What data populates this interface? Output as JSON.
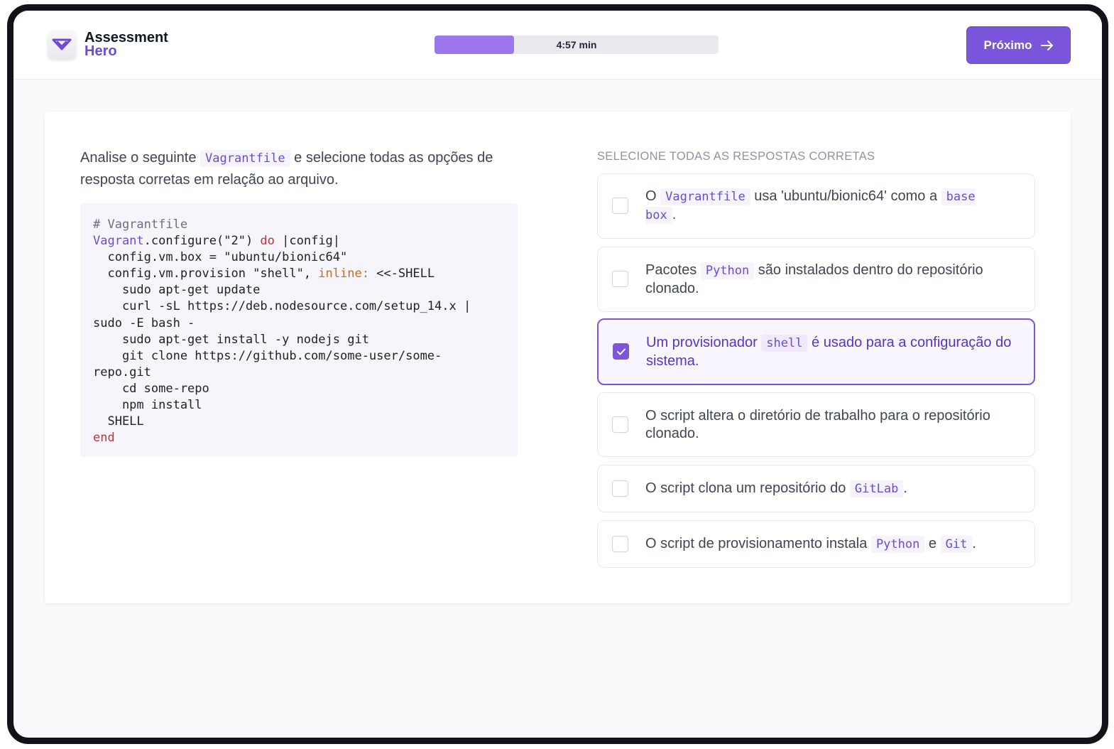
{
  "app": {
    "logo_line1": "Assessment",
    "logo_line2": "Hero",
    "brand_color": "#7c55dd"
  },
  "timer": {
    "label": "4:57 min",
    "progress": 0.28
  },
  "next_button": {
    "label": "Próximo",
    "icon": "arrow-right-icon"
  },
  "question": {
    "text_before": "Analise o seguinte ",
    "code": "Vagrantfile",
    "text_after": " e selecione todas as opções de resposta corretas em relação ao arquivo."
  },
  "code_block": {
    "language": "ruby",
    "comment": "# Vagrantfile",
    "line2_class": "Vagrant",
    "line2_rest": ".configure(\"2\") ",
    "line2_kw": "do",
    "line2_end": " |config|",
    "line3": "  config.vm.box = \"ubuntu/bionic64\"",
    "line4_start": "  config.vm.provision \"shell\", ",
    "line4_sym": "inline:",
    "line4_end": " <<-SHELL",
    "line5": "    sudo apt-get update",
    "line6": "    curl -sL https://deb.nodesource.com/setup_14.x |",
    "line7": "sudo -E bash -",
    "line8": "    sudo apt-get install -y nodejs git",
    "line9": "    git clone https://github.com/some-user/some-",
    "line10": "repo.git",
    "line11": "    cd some-repo",
    "line12": "    npm install",
    "line13": "  SHELL",
    "line14": "end"
  },
  "answers": {
    "header": "SELECIONE TODAS AS RESPOSTAS CORRETAS",
    "options": [
      {
        "checked": false,
        "t1": "O ",
        "c1": "Vagrantfile",
        "t2": " usa 'ubuntu/bionic64' como a ",
        "c2": "base box",
        "t3": "."
      },
      {
        "checked": false,
        "t1": "Pacotes ",
        "c1": "Python",
        "t2": " são instalados dentro do repositório clonado."
      },
      {
        "checked": true,
        "t1": "Um provisionador ",
        "c1": "shell",
        "t2": " é usado para a configuração do sistema."
      },
      {
        "checked": false,
        "t1": "O script altera o diretório de trabalho para o repositório clonado."
      },
      {
        "checked": false,
        "t1": "O script clona um repositório do ",
        "c1": "GitLab",
        "t2": "."
      },
      {
        "checked": false,
        "t1": "O script de provisionamento instala ",
        "c1": "Python",
        "t2": " e ",
        "c2": "Git",
        "t3": "."
      }
    ]
  }
}
